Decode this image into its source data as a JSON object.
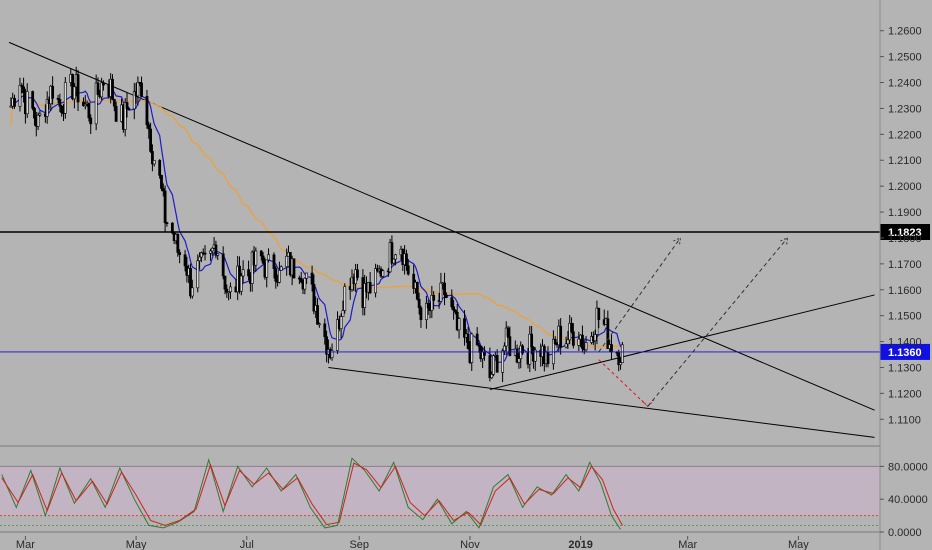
{
  "chart_data": {
    "type": "candlestick",
    "main_panel": {
      "y_ticks": [
        "1.2600",
        "1.2500",
        "1.2400",
        "1.2300",
        "1.2200",
        "1.2100",
        "1.2000",
        "1.1900",
        "1.1800",
        "1.1700",
        "1.1600",
        "1.1500",
        "1.1400",
        "1.1300",
        "1.1200",
        "1.1100"
      ],
      "ylim": [
        1.102,
        1.268
      ],
      "resistance_level": {
        "value": 1.1823,
        "label": "1.1823"
      },
      "current_price": {
        "value": 1.136,
        "label": "1.1360"
      },
      "trendlines": [
        {
          "kind": "falling-resistance",
          "points": [
            [
              "2018-02-20",
              1.2555
            ],
            [
              "2019-06-12",
              1.1135
            ]
          ]
        },
        {
          "kind": "lower-channel",
          "points": [
            [
              "2018-08-15",
              1.13
            ],
            [
              "2019-06-12",
              1.103
            ]
          ]
        },
        {
          "kind": "rising-support",
          "points": [
            [
              "2018-11-12",
              1.1215
            ],
            [
              "2019-06-12",
              1.158
            ]
          ]
        }
      ],
      "projection_red": [
        [
          "2019-01-11",
          1.133
        ],
        [
          "2019-02-07",
          1.115
        ]
      ],
      "projection_scenarios": [
        [
          [
            "2019-01-11",
            1.136
          ],
          [
            "2019-02-25",
            1.18
          ]
        ],
        [
          [
            "2019-02-07",
            1.115
          ],
          [
            "2019-04-25",
            1.18
          ]
        ]
      ],
      "series": [
        {
          "name": "",
          "type": "ohlc-close",
          "points": [
            [
              "2018-02-21",
              1.231
            ],
            [
              "2018-02-26",
              1.242
            ],
            [
              "2018-03-01",
              1.233
            ],
            [
              "2018-03-05",
              1.229
            ],
            [
              "2018-03-08",
              1.224
            ],
            [
              "2018-03-12",
              1.232
            ],
            [
              "2018-03-16",
              1.238
            ],
            [
              "2018-03-20",
              1.231
            ],
            [
              "2018-03-24",
              1.236
            ],
            [
              "2018-03-28",
              1.239
            ],
            [
              "2018-04-02",
              1.232
            ],
            [
              "2018-04-06",
              1.228
            ],
            [
              "2018-04-10",
              1.236
            ],
            [
              "2018-04-13",
              1.241
            ],
            [
              "2018-04-17",
              1.238
            ],
            [
              "2018-04-20",
              1.23
            ],
            [
              "2018-04-24",
              1.225
            ],
            [
              "2018-04-27",
              1.233
            ],
            [
              "2018-05-01",
              1.236
            ],
            [
              "2018-05-04",
              1.239
            ],
            [
              "2018-05-07",
              1.227
            ],
            [
              "2018-05-10",
              1.214
            ],
            [
              "2018-05-14",
              1.202
            ],
            [
              "2018-05-17",
              1.188
            ],
            [
              "2018-05-21",
              1.182
            ],
            [
              "2018-05-24",
              1.175
            ],
            [
              "2018-05-28",
              1.172
            ],
            [
              "2018-05-31",
              1.162
            ],
            [
              "2018-06-04",
              1.168
            ],
            [
              "2018-06-07",
              1.169
            ],
            [
              "2018-06-11",
              1.172
            ],
            [
              "2018-06-14",
              1.179
            ],
            [
              "2018-06-18",
              1.167
            ],
            [
              "2018-06-21",
              1.157
            ],
            [
              "2018-06-25",
              1.162
            ],
            [
              "2018-06-28",
              1.167
            ],
            [
              "2018-07-02",
              1.166
            ],
            [
              "2018-07-05",
              1.17
            ],
            [
              "2018-07-09",
              1.172
            ],
            [
              "2018-07-12",
              1.168
            ],
            [
              "2018-07-16",
              1.171
            ],
            [
              "2018-07-19",
              1.165
            ],
            [
              "2018-07-23",
              1.171
            ],
            [
              "2018-07-26",
              1.168
            ],
            [
              "2018-07-30",
              1.17
            ],
            [
              "2018-08-02",
              1.164
            ],
            [
              "2018-08-06",
              1.158
            ],
            [
              "2018-08-09",
              1.152
            ],
            [
              "2018-08-13",
              1.142
            ],
            [
              "2018-08-16",
              1.137
            ],
            [
              "2018-08-20",
              1.145
            ],
            [
              "2018-08-23",
              1.158
            ],
            [
              "2018-08-27",
              1.165
            ],
            [
              "2018-08-30",
              1.168
            ],
            [
              "2018-09-03",
              1.159
            ],
            [
              "2018-09-06",
              1.16
            ],
            [
              "2018-09-10",
              1.163
            ],
            [
              "2018-09-13",
              1.168
            ],
            [
              "2018-09-17",
              1.172
            ],
            [
              "2018-09-20",
              1.177
            ],
            [
              "2018-09-24",
              1.178
            ],
            [
              "2018-09-27",
              1.17
            ],
            [
              "2018-10-01",
              1.16
            ],
            [
              "2018-10-04",
              1.154
            ],
            [
              "2018-10-08",
              1.15
            ],
            [
              "2018-10-11",
              1.153
            ],
            [
              "2018-10-15",
              1.156
            ],
            [
              "2018-10-18",
              1.159
            ],
            [
              "2018-10-22",
              1.151
            ],
            [
              "2018-10-25",
              1.144
            ],
            [
              "2018-10-29",
              1.14
            ],
            [
              "2018-11-01",
              1.137
            ],
            [
              "2018-11-05",
              1.138
            ],
            [
              "2018-11-08",
              1.133
            ],
            [
              "2018-11-12",
              1.126
            ],
            [
              "2018-11-15",
              1.132
            ],
            [
              "2018-11-19",
              1.138
            ],
            [
              "2018-11-22",
              1.14
            ],
            [
              "2018-11-26",
              1.135
            ],
            [
              "2018-11-29",
              1.138
            ],
            [
              "2018-12-03",
              1.137
            ],
            [
              "2018-12-06",
              1.138
            ],
            [
              "2018-12-10",
              1.138
            ],
            [
              "2018-12-13",
              1.133
            ],
            [
              "2018-12-17",
              1.136
            ],
            [
              "2018-12-20",
              1.142
            ],
            [
              "2018-12-24",
              1.141
            ],
            [
              "2018-12-27",
              1.143
            ],
            [
              "2018-12-31",
              1.145
            ],
            [
              "2019-01-03",
              1.138
            ],
            [
              "2019-01-07",
              1.144
            ],
            [
              "2019-01-10",
              1.15
            ],
            [
              "2019-01-14",
              1.146
            ],
            [
              "2019-01-17",
              1.14
            ],
            [
              "2019-01-21",
              1.137
            ],
            [
              "2019-01-24",
              1.136
            ]
          ]
        },
        {
          "name": "",
          "type": "fast-moving-average",
          "color": "#1c1cc8"
        },
        {
          "name": "",
          "type": "slow-moving-average",
          "color": "#f0a030"
        }
      ]
    },
    "x_axis": {
      "range": [
        "2018-02-15",
        "2019-06-15"
      ],
      "ticks": [
        {
          "date": "2018-03-01",
          "label": "Mar",
          "bold": false
        },
        {
          "date": "2018-05-01",
          "label": "May",
          "bold": false
        },
        {
          "date": "2018-07-01",
          "label": "Jul",
          "bold": false
        },
        {
          "date": "2018-09-01",
          "label": "Sep",
          "bold": false
        },
        {
          "date": "2018-11-01",
          "label": "Nov",
          "bold": false
        },
        {
          "date": "2019-01-01",
          "label": "2019",
          "bold": true
        },
        {
          "date": "2019-03-01",
          "label": "Mar",
          "bold": false
        },
        {
          "date": "2019-05-01",
          "label": "May",
          "bold": false
        }
      ]
    },
    "oscillator_panel": {
      "y_ticks": [
        "80.0000",
        "40.0000",
        "0.0000"
      ],
      "ylim": [
        0,
        100
      ],
      "overbought": 80,
      "oversold": 20,
      "series": [
        {
          "name": "",
          "color": "#2e7d2e",
          "points": [
            [
              "2018-02-16",
              70
            ],
            [
              "2018-02-24",
              30
            ],
            [
              "2018-03-04",
              75
            ],
            [
              "2018-03-12",
              20
            ],
            [
              "2018-03-20",
              78
            ],
            [
              "2018-03-28",
              35
            ],
            [
              "2018-04-06",
              65
            ],
            [
              "2018-04-14",
              30
            ],
            [
              "2018-04-22",
              78
            ],
            [
              "2018-04-30",
              40
            ],
            [
              "2018-05-08",
              8
            ],
            [
              "2018-05-16",
              5
            ],
            [
              "2018-05-24",
              12
            ],
            [
              "2018-06-02",
              25
            ],
            [
              "2018-06-10",
              88
            ],
            [
              "2018-06-18",
              25
            ],
            [
              "2018-06-26",
              80
            ],
            [
              "2018-07-04",
              55
            ],
            [
              "2018-07-12",
              78
            ],
            [
              "2018-07-20",
              50
            ],
            [
              "2018-07-28",
              70
            ],
            [
              "2018-08-05",
              30
            ],
            [
              "2018-08-13",
              5
            ],
            [
              "2018-08-20",
              8
            ],
            [
              "2018-08-28",
              90
            ],
            [
              "2018-09-04",
              75
            ],
            [
              "2018-09-12",
              50
            ],
            [
              "2018-09-20",
              85
            ],
            [
              "2018-09-28",
              30
            ],
            [
              "2018-10-06",
              15
            ],
            [
              "2018-10-14",
              40
            ],
            [
              "2018-10-22",
              10
            ],
            [
              "2018-10-30",
              25
            ],
            [
              "2018-11-06",
              5
            ],
            [
              "2018-11-14",
              55
            ],
            [
              "2018-11-22",
              70
            ],
            [
              "2018-11-30",
              30
            ],
            [
              "2018-12-08",
              55
            ],
            [
              "2018-12-16",
              45
            ],
            [
              "2018-12-24",
              70
            ],
            [
              "2018-12-31",
              50
            ],
            [
              "2019-01-06",
              85
            ],
            [
              "2019-01-12",
              60
            ],
            [
              "2019-01-18",
              20
            ],
            [
              "2019-01-23",
              3
            ]
          ]
        },
        {
          "name": "",
          "color": "#d02020",
          "points": [
            [
              "2018-02-16",
              66
            ],
            [
              "2018-02-25",
              36
            ],
            [
              "2018-03-05",
              70
            ],
            [
              "2018-03-13",
              26
            ],
            [
              "2018-03-21",
              72
            ],
            [
              "2018-03-29",
              38
            ],
            [
              "2018-04-07",
              62
            ],
            [
              "2018-04-15",
              34
            ],
            [
              "2018-04-23",
              73
            ],
            [
              "2018-05-01",
              45
            ],
            [
              "2018-05-09",
              14
            ],
            [
              "2018-05-17",
              8
            ],
            [
              "2018-05-25",
              14
            ],
            [
              "2018-06-03",
              28
            ],
            [
              "2018-06-11",
              82
            ],
            [
              "2018-06-19",
              32
            ],
            [
              "2018-06-27",
              75
            ],
            [
              "2018-07-05",
              58
            ],
            [
              "2018-07-13",
              72
            ],
            [
              "2018-07-21",
              52
            ],
            [
              "2018-07-29",
              66
            ],
            [
              "2018-08-06",
              34
            ],
            [
              "2018-08-14",
              9
            ],
            [
              "2018-08-21",
              12
            ],
            [
              "2018-08-29",
              84
            ],
            [
              "2018-09-05",
              76
            ],
            [
              "2018-09-13",
              54
            ],
            [
              "2018-09-21",
              80
            ],
            [
              "2018-09-29",
              36
            ],
            [
              "2018-10-07",
              20
            ],
            [
              "2018-10-15",
              38
            ],
            [
              "2018-10-23",
              14
            ],
            [
              "2018-10-31",
              24
            ],
            [
              "2018-11-07",
              9
            ],
            [
              "2018-11-15",
              50
            ],
            [
              "2018-11-23",
              66
            ],
            [
              "2018-12-01",
              34
            ],
            [
              "2018-12-09",
              52
            ],
            [
              "2018-12-17",
              47
            ],
            [
              "2018-12-25",
              66
            ],
            [
              "2019-01-01",
              54
            ],
            [
              "2019-01-07",
              80
            ],
            [
              "2019-01-13",
              64
            ],
            [
              "2019-01-19",
              28
            ],
            [
              "2019-01-24",
              8
            ]
          ]
        }
      ]
    }
  },
  "colors": {
    "background": "#b4b4b4",
    "oscillator_band": "#c6b4c6",
    "candle": "#000000",
    "fast_ma": "#1c1cc8",
    "slow_ma": "#f0a030",
    "current_price": "#1010e0",
    "projection_red": "#e01010"
  }
}
